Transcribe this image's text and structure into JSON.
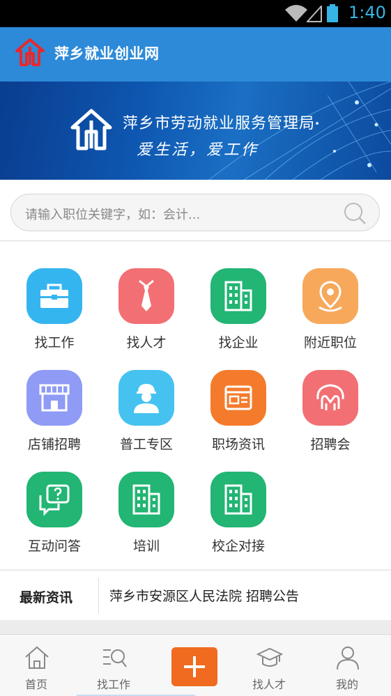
{
  "status_bar": {
    "time": "1:40",
    "icons": [
      "wifi-icon",
      "signal-icon",
      "battery-icon"
    ]
  },
  "header": {
    "title": "萍乡就业创业网",
    "logo_icon": "house-emblem-icon"
  },
  "banner": {
    "org_name": "萍乡市劳动就业服务管理局",
    "slogan": "爱生活，爱工作"
  },
  "search": {
    "placeholder": "请输入职位关键字，如：会计..."
  },
  "grid": {
    "items": [
      {
        "label": "找工作",
        "icon": "briefcase-icon",
        "color": "#35b5ef"
      },
      {
        "label": "找人才",
        "icon": "tie-icon",
        "color": "#f26f73"
      },
      {
        "label": "找企业",
        "icon": "building-icon",
        "color": "#22b573"
      },
      {
        "label": "附近职位",
        "icon": "location-pin-icon",
        "color": "#f7a85a"
      },
      {
        "label": "店铺招聘",
        "icon": "storefront-icon",
        "color": "#8f9bf5"
      },
      {
        "label": "普工专区",
        "icon": "worker-icon",
        "color": "#46c2f0"
      },
      {
        "label": "职场资讯",
        "icon": "newspaper-icon",
        "color": "#f47b2c"
      },
      {
        "label": "招聘会",
        "icon": "handshake-icon",
        "color": "#f26f73"
      },
      {
        "label": "互动问答",
        "icon": "chat-question-icon",
        "color": "#22b573"
      },
      {
        "label": "培训",
        "icon": "building-icon",
        "color": "#22b573"
      },
      {
        "label": "校企对接",
        "icon": "building-icon",
        "color": "#22b573"
      }
    ]
  },
  "news": {
    "label": "最新资讯",
    "headline": "萍乡市安源区人民法院 招聘公告"
  },
  "bottom_nav": {
    "items": [
      {
        "label": "首页",
        "icon": "home-icon"
      },
      {
        "label": "找工作",
        "icon": "search-list-icon"
      },
      {
        "label": "找人才",
        "icon": "graduation-cap-icon"
      },
      {
        "label": "我的",
        "icon": "person-icon"
      }
    ],
    "add_icon": "plus-icon",
    "add_color": "#f06b1f"
  }
}
